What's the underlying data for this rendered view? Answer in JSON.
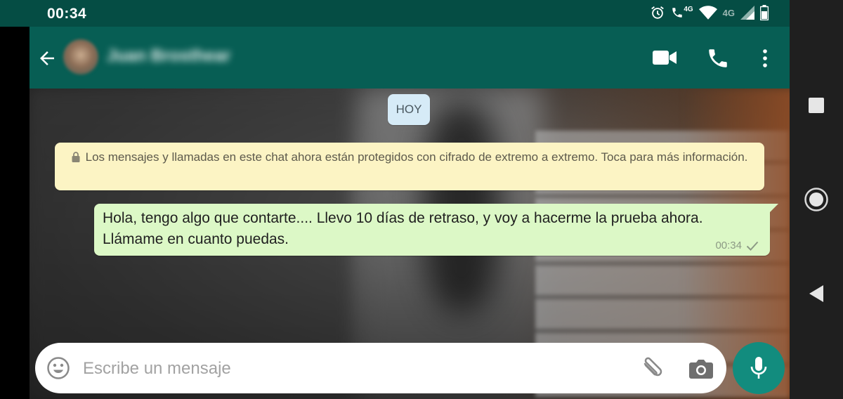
{
  "status_bar": {
    "time": "00:34",
    "network_label_1": "4G",
    "network_label_2": "4G",
    "icons": [
      "alarm-icon",
      "wifi-call-icon",
      "wifi-icon",
      "signal-icon",
      "battery-icon"
    ]
  },
  "header": {
    "contact_name": "Juan Brosthear",
    "icons": [
      "back-arrow-icon",
      "video-call-icon",
      "phone-icon",
      "more-vert-icon"
    ]
  },
  "chat": {
    "date_chip": "HOY",
    "encryption_notice": "Los mensajes y llamadas en este chat ahora están protegidos con cifrado de extremo a extremo. Toca para más información.",
    "messages": [
      {
        "text": "Hola, tengo algo que contarte.... Llevo 10 días de retraso, y voy a hacerme la prueba ahora. Llámame en cuanto puedas.",
        "time": "00:34",
        "status_icon": "single-check-icon"
      }
    ]
  },
  "composer": {
    "placeholder": "Escribe un mensaje",
    "value": "",
    "icons": [
      "emoji-icon",
      "attach-icon",
      "camera-icon",
      "mic-icon"
    ]
  },
  "nav_bar": {
    "icons": [
      "recents-square-icon",
      "home-circle-icon",
      "back-triangle-icon"
    ]
  },
  "colors": {
    "header": "#075e54",
    "status_bar": "#054d44",
    "outgoing_bubble": "#dcf8c6",
    "notice_bubble": "#fcf4c4",
    "date_chip": "#d6ebf7",
    "mic_button": "#128c7e"
  }
}
